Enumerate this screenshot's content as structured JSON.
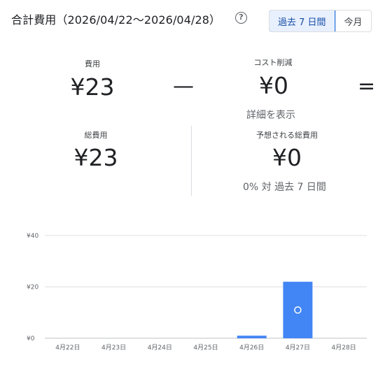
{
  "header": {
    "title": "合計費用（2026/04/22〜2026/04/28）",
    "help_icon": "help-circle-icon",
    "range_options": [
      "過去 7 日間",
      "今月"
    ],
    "selected_range": "過去 7 日間"
  },
  "summary": {
    "cost_label": "費用",
    "cost_value": "¥23",
    "minus_sign": "—",
    "savings_label": "コスト削減",
    "savings_value": "¥0",
    "equals_sign": "=",
    "details_link": "詳細を表示"
  },
  "totals": {
    "total_cost_label": "総費用",
    "total_cost_value": "¥23",
    "forecast_label": "予想される総費用",
    "forecast_value": "¥0",
    "comparison": "0% 対 過去 7 日間"
  },
  "colors": {
    "accent": "#1a73e8",
    "bar": "#4285f4",
    "selected_bg": "#e8f0fe",
    "grid": "#e0e0e0"
  },
  "chart_data": {
    "type": "bar",
    "categories": [
      "4月22日",
      "4月23日",
      "4月24日",
      "4月25日",
      "4月26日",
      "4月27日",
      "4月28日"
    ],
    "values": [
      0,
      0,
      0,
      0,
      1,
      22,
      0
    ],
    "y_ticks": [
      "¥0",
      "¥20",
      "¥40"
    ],
    "ylim": [
      0,
      40
    ],
    "grid": true,
    "marker_on_category": "4月27日",
    "title": "",
    "xlabel": "",
    "ylabel": ""
  }
}
